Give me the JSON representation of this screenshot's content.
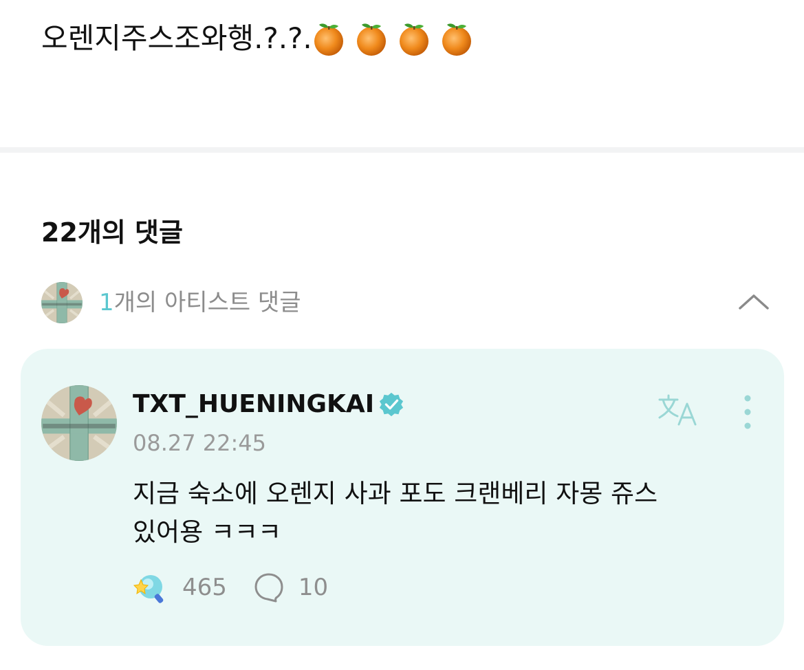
{
  "post": {
    "text": "오렌지주스조와행.?.?.",
    "emoji_icons": [
      "orange-icon",
      "orange-icon",
      "orange-icon",
      "orange-icon"
    ]
  },
  "comments": {
    "title": "22개의 댓글",
    "artist_section": {
      "count": "1",
      "label_suffix": "개의 아티스트 댓글",
      "collapse_icon": "chevron-up-icon"
    },
    "items": [
      {
        "username": "TXT_HUENINGKAI",
        "verified": true,
        "timestamp": "08.27 22:45",
        "body_line1": "지금 숙소에 오렌지 사과 포도 크랜베리 자몽 쥬스",
        "body_line2": "있어용 ㅋㅋㅋ",
        "likes": "465",
        "replies": "10",
        "translate_icon": "translate-icon",
        "more_icon": "more-vertical-icon"
      }
    ]
  },
  "colors": {
    "accent": "#5bc7cf",
    "card_bg": "#eaf8f6",
    "muted_text": "#8c8c8c",
    "divider": "#f2f3f4"
  }
}
